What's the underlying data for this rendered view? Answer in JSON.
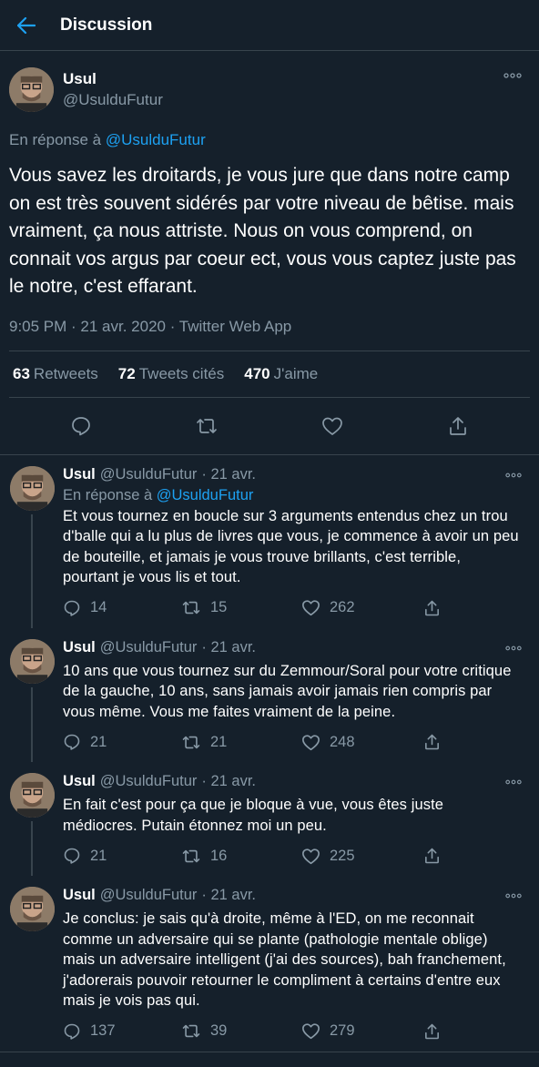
{
  "header": {
    "title": "Discussion"
  },
  "main_tweet": {
    "name": "Usul",
    "handle": "@UsulduFutur",
    "reply_prefix": "En réponse à",
    "reply_to": "@UsulduFutur",
    "text": "Vous savez les droitards, je vous jure que dans notre camp on est très souvent sidérés par votre niveau de bêtise. mais vraiment, ça nous attriste. Nous on vous comprend, on connait vos argus par coeur ect, vous vous captez juste pas le notre, c'est effarant.",
    "meta": "9:05 PM · 21 avr. 2020 · Twitter Web App",
    "retweets_count": "63",
    "retweets_label": "Retweets",
    "quotes_count": "72",
    "quotes_label": "Tweets cités",
    "likes_count": "470",
    "likes_label": "J'aime"
  },
  "replies": [
    {
      "name": "Usul",
      "handle": "@UsulduFutur",
      "date": "· 21 avr.",
      "reply_prefix": "En réponse à",
      "reply_to": "@UsulduFutur",
      "text": "Et vous tournez en boucle sur 3 arguments entendus chez un trou d'balle qui a lu plus de livres que vous, je commence à avoir un peu de bouteille, et jamais je vous trouve brillants, c'est terrible, pourtant je vous lis et tout.",
      "replies": "14",
      "retweets": "15",
      "likes": "262"
    },
    {
      "name": "Usul",
      "handle": "@UsulduFutur",
      "date": "· 21 avr.",
      "text": "10 ans que vous tournez sur du Zemmour/Soral pour votre critique de la gauche, 10 ans, sans jamais avoir jamais rien compris par vous même. Vous me faites vraiment de la peine.",
      "replies": "21",
      "retweets": "21",
      "likes": "248"
    },
    {
      "name": "Usul",
      "handle": "@UsulduFutur",
      "date": "· 21 avr.",
      "text": "En fait c'est pour ça que je bloque à vue, vous êtes juste médiocres. Putain étonnez moi un peu.",
      "replies": "21",
      "retweets": "16",
      "likes": "225"
    },
    {
      "name": "Usul",
      "handle": "@UsulduFutur",
      "date": "· 21 avr.",
      "text": "Je conclus: je sais qu'à droite, même à l'ED, on me reconnait comme un adversaire qui se plante (pathologie mentale oblige) mais un adversaire intelligent (j'ai des sources), bah franchement, j'adorerais pouvoir retourner le compliment à certains d'entre eux mais je vois pas qui.",
      "replies": "137",
      "retweets": "39",
      "likes": "279"
    }
  ],
  "icons": {
    "back": "arrow-left-icon",
    "more": "more-dots-icon",
    "reply": "reply-bubble-icon",
    "retweet": "retweet-icon",
    "like": "heart-icon",
    "share": "share-icon"
  },
  "colors": {
    "background": "#15202b",
    "accent": "#1da1f2",
    "muted": "#8899a6",
    "border": "#38444d"
  }
}
